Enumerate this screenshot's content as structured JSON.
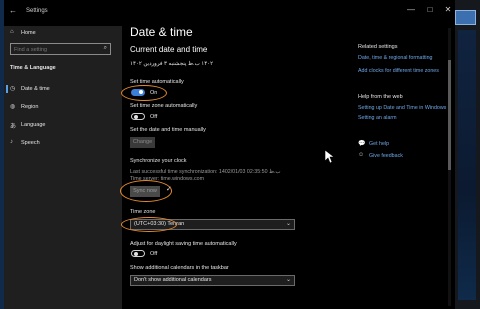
{
  "window": {
    "title": "Settings",
    "minimize": "—",
    "maximize": "□",
    "close": "✕"
  },
  "sidebar": {
    "home": "Home",
    "search_placeholder": "Find a setting",
    "category": "Time & Language",
    "items": [
      {
        "label": "Date & time",
        "icon": "clock-icon"
      },
      {
        "label": "Region",
        "icon": "globe-icon"
      },
      {
        "label": "Language",
        "icon": "language-icon"
      },
      {
        "label": "Speech",
        "icon": "microphone-icon"
      }
    ]
  },
  "main": {
    "title": "Date & time",
    "section_title": "Current date and time",
    "current_datetime": "۱۴۰۲ ب.ظ پنجشنبه ۳ فروردین ۱۴۰۲",
    "set_time_auto": {
      "label": "Set time automatically",
      "state": "On"
    },
    "set_timezone_auto": {
      "label": "Set time zone automatically",
      "state": "Off"
    },
    "manual": {
      "label": "Set the date and time manually",
      "button": "Change"
    },
    "sync": {
      "heading": "Synchronize your clock",
      "last_sync": "Last successful time synchronization: ب.ظ 02:35:50 1402/01/03",
      "server": "Time server: time.windows.com",
      "button": "Sync now"
    },
    "timezone": {
      "label": "Time zone",
      "value": "(UTC+03:30) Tehran"
    },
    "dst": {
      "label": "Adjust for daylight saving time automatically",
      "state": "Off"
    },
    "calendars": {
      "label": "Show additional calendars in the taskbar",
      "value": "Don't show additional calendars"
    }
  },
  "related": {
    "heading": "Related settings",
    "links": [
      "Date, time & regional formatting",
      "Add clocks for different time zones"
    ]
  },
  "help": {
    "heading": "Help from the web",
    "links": [
      "Setting up Date and Time in Windows",
      "Setting an alarm"
    ]
  },
  "support": {
    "get_help": "Get help",
    "feedback": "Give feedback"
  },
  "colors": {
    "accent": "#3d7fd6",
    "highlight_oval": "#e58a2e",
    "link": "#6ea8e8"
  }
}
